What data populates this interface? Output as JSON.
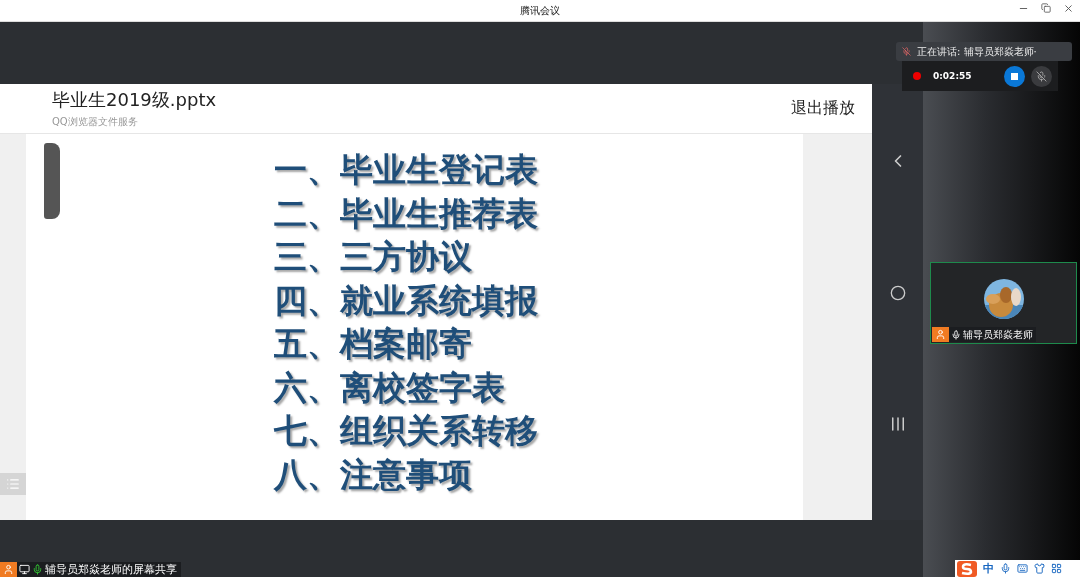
{
  "window": {
    "title": "腾讯会议"
  },
  "document": {
    "title": "毕业生2019级.pptx",
    "subtitle": "QQ浏览器文件服务",
    "exit_button": "退出播放"
  },
  "slide": {
    "items": [
      "一、毕业生登记表",
      "二、毕业生推荐表",
      "三、三方协议",
      "四、就业系统填报",
      "五、档案邮寄",
      "六、离校签字表",
      "七、组织关系转移",
      "八、注意事项"
    ]
  },
  "speaking": {
    "text": "正在讲话: 辅导员郑焱老师·"
  },
  "recording": {
    "time": "0:02:55",
    "mic_muted": true
  },
  "participant": {
    "name": "辅导员郑焱老师",
    "active": true
  },
  "share_label": "辅导员郑焱老师的屏幕共享",
  "ime": {
    "mode": "中"
  }
}
